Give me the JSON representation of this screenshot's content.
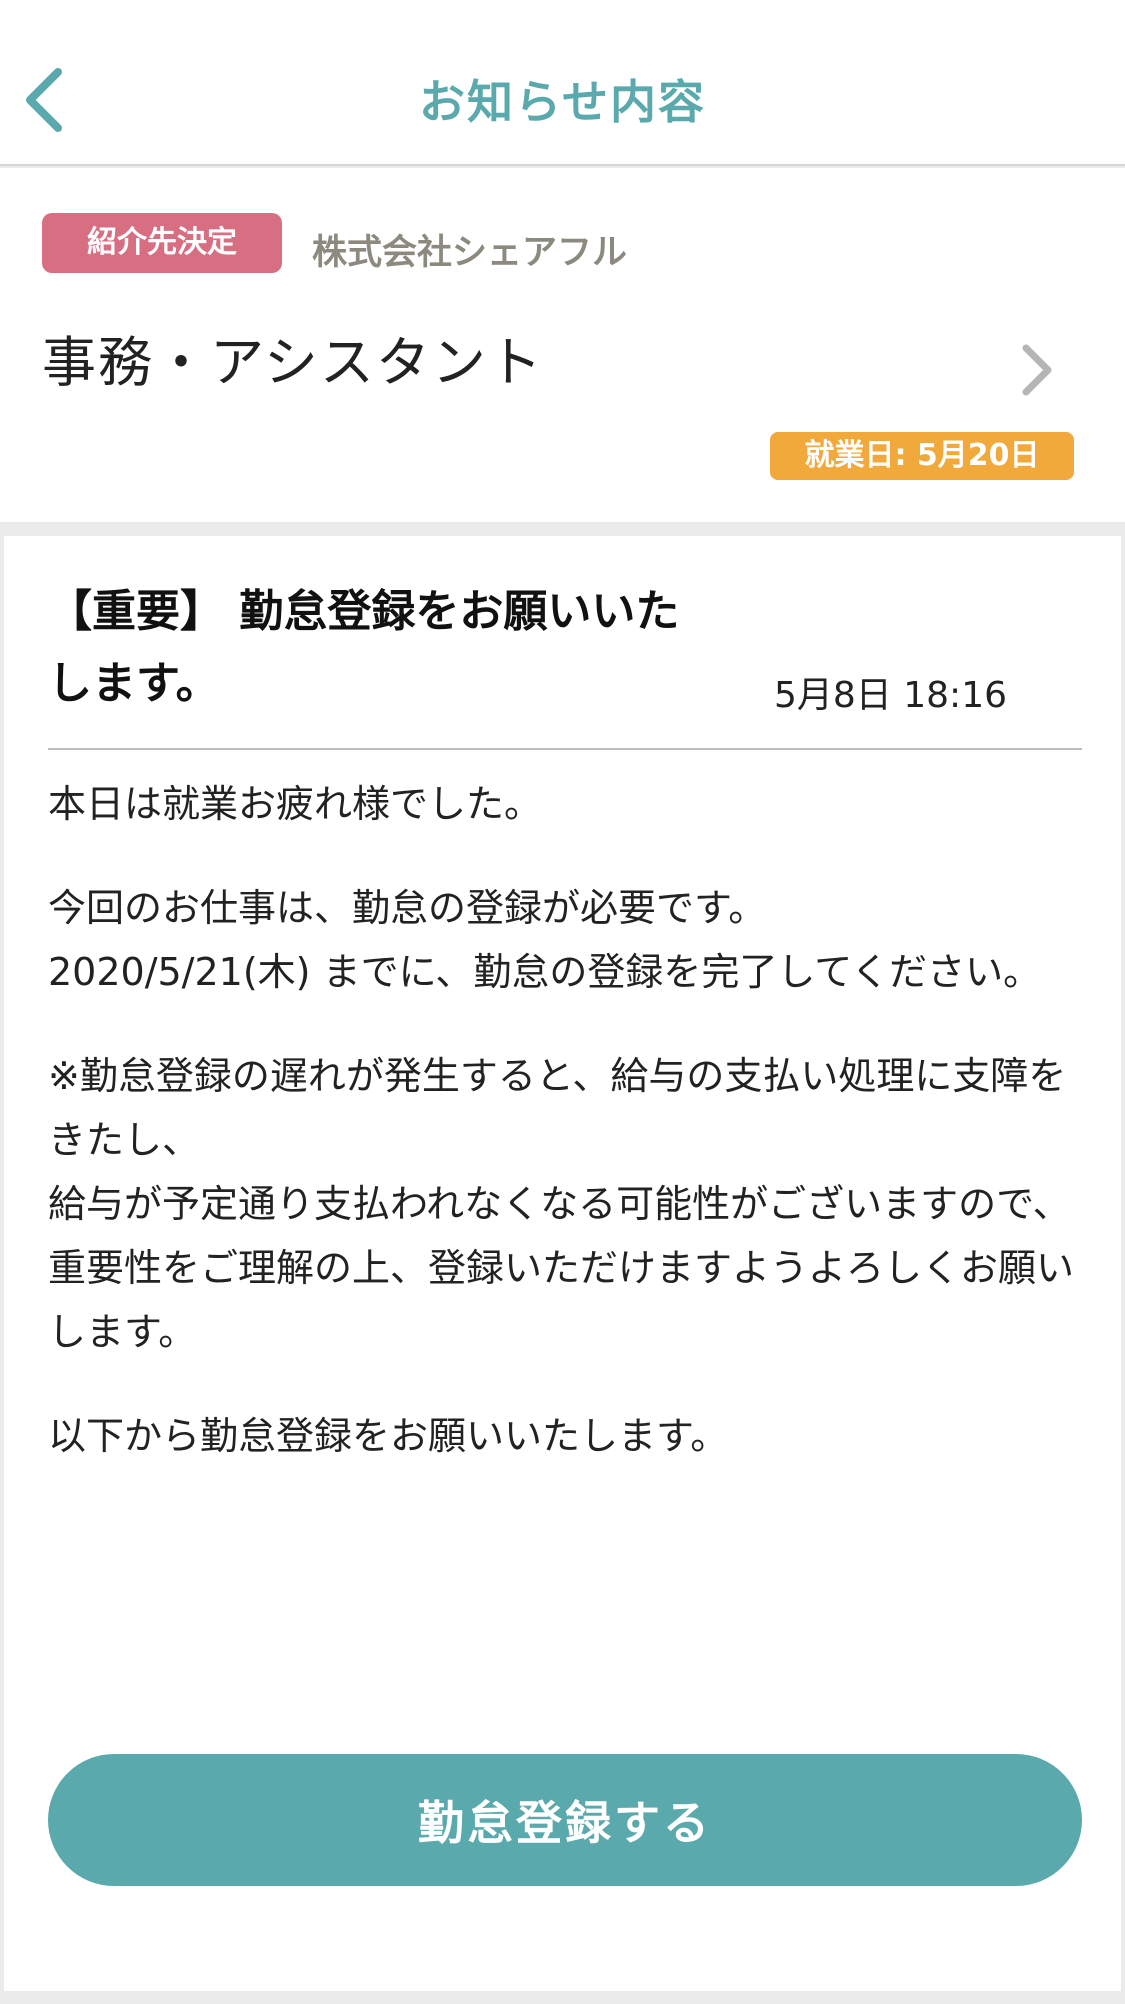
{
  "nav": {
    "title": "お知らせ内容",
    "back_icon": "chevron-left-icon"
  },
  "job": {
    "status_label": "紹介先決定",
    "company": "株式会社シェアフル",
    "title": "事務・アシスタント",
    "workday_label": "就業日: 5月20日",
    "chevron_icon": "chevron-right-icon"
  },
  "message": {
    "title": "【重要】 勤怠登録をお願いいたします。",
    "time": "5月8日 18:16",
    "paragraphs": [
      "本日は就業お疲れ様でした。",
      "今回のお仕事は、勤怠の登録が必要です。\n2020/5/21(木) までに、勤怠の登録を完了してください。",
      "※勤怠登録の遅れが発生すると、給与の支払い処理に支障をきたし、\n給与が予定通り支払われなくなる可能性がございますので、\n重要性をご理解の上、登録いただけますようよろしくお願いします。",
      "以下から勤怠登録をお願いいたします。"
    ],
    "button_label": "勤怠登録する"
  },
  "colors": {
    "accent": "#5aa9ad",
    "status_badge": "#d86e82",
    "workday_badge": "#f0a93a"
  }
}
